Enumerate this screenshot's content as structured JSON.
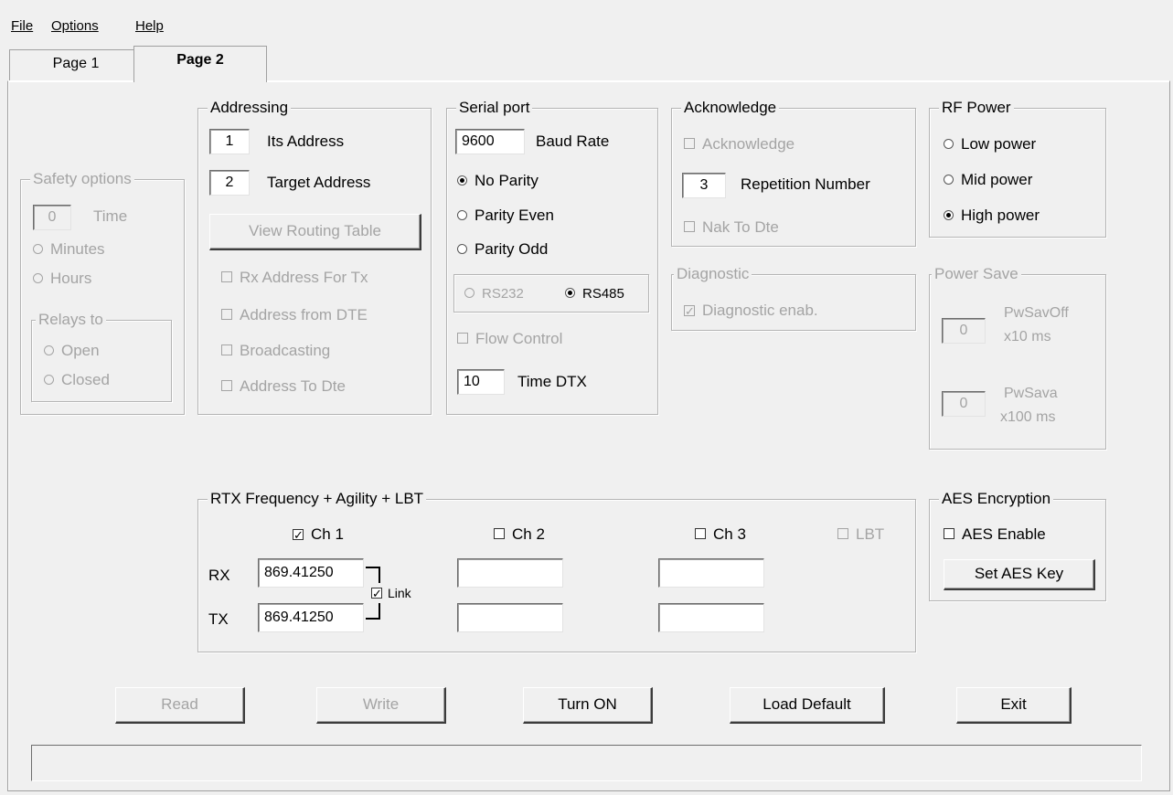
{
  "menu": {
    "file": "File",
    "options": "Options",
    "help": "Help"
  },
  "tabs": {
    "page1": "Page 1",
    "page2": "Page 2"
  },
  "safety": {
    "title": "Safety options",
    "time_value": "0",
    "time_label": "Time",
    "minutes": "Minutes",
    "hours": "Hours",
    "relays_title": "Relays to",
    "open": "Open",
    "closed": "Closed"
  },
  "addressing": {
    "title": "Addressing",
    "its_address_value": "1",
    "its_address_label": "Its Address",
    "target_address_value": "2",
    "target_address_label": "Target Address",
    "view_routing": "View Routing Table",
    "rx_address_for_tx": "Rx Address For Tx",
    "address_from_dte": "Address from DTE",
    "broadcasting": "Broadcasting",
    "address_to_dte": "Address To Dte"
  },
  "serial": {
    "title": "Serial port",
    "baud_value": "9600",
    "baud_label": "Baud Rate",
    "no_parity": "No Parity",
    "parity_even": "Parity Even",
    "parity_odd": "Parity Odd",
    "rs232": "RS232",
    "rs485": "RS485",
    "flow_control": "Flow Control",
    "dtx_value": "10",
    "dtx_label": "Time DTX"
  },
  "acknowledge": {
    "title": "Acknowledge",
    "acknowledge": "Acknowledge",
    "repetition_value": "3",
    "repetition_label": "Repetition Number",
    "nak_to_dte": "Nak To Dte"
  },
  "diagnostic": {
    "title": "Diagnostic",
    "enab": "Diagnostic enab."
  },
  "rf_power": {
    "title": "RF Power",
    "low": "Low power",
    "mid": "Mid power",
    "high": "High power"
  },
  "power_save": {
    "title": "Power Save",
    "off_value": "0",
    "off_label1": "PwSavOff",
    "off_label2": "x10 ms",
    "sava_value": "0",
    "sava_label1": "PwSava",
    "sava_label2": "x100 ms"
  },
  "rtx": {
    "title": "RTX Frequency + Agility + LBT",
    "ch1": "Ch 1",
    "ch2": "Ch 2",
    "ch3": "Ch 3",
    "lbt": "LBT",
    "rx_label": "RX",
    "tx_label": "TX",
    "ch1_rx": "869.41250",
    "ch1_tx": "869.41250",
    "ch2_rx": "",
    "ch2_tx": "",
    "ch3_rx": "",
    "ch3_tx": "",
    "link": "Link"
  },
  "aes": {
    "title": "AES Encryption",
    "enable": "AES Enable",
    "set_key": "Set AES Key"
  },
  "buttons": {
    "read": "Read",
    "write": "Write",
    "turn_on": "Turn ON",
    "load_default": "Load Default",
    "exit": "Exit"
  },
  "status_text": ""
}
